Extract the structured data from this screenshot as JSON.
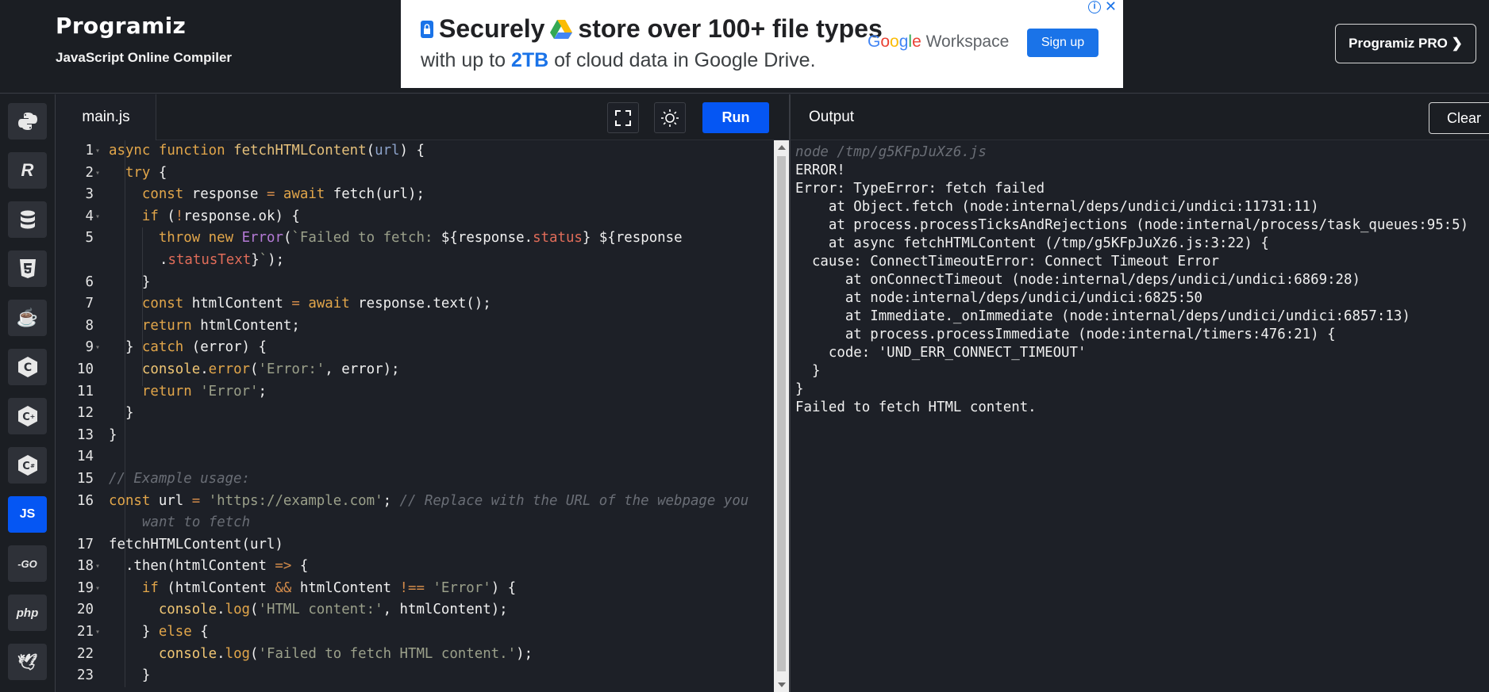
{
  "header": {
    "brand": "Programiz",
    "subtitle": "JavaScript Online Compiler",
    "pro_button": "Programiz PRO ❯"
  },
  "ad": {
    "line1_a": "Securely",
    "line1_b": "store over 100+ file types",
    "line2_a": "with up to",
    "line2_hl": "2TB",
    "line2_b": "of cloud data in Google Drive.",
    "google": [
      "G",
      "o",
      "o",
      "g",
      "l",
      "e"
    ],
    "workspace": " Workspace",
    "signup": "Sign up",
    "info": "i",
    "close": "✕"
  },
  "sidebar": {
    "languages": [
      {
        "name": "python",
        "label": "🐍"
      },
      {
        "name": "r",
        "label": "R"
      },
      {
        "name": "sql",
        "label": "≡"
      },
      {
        "name": "html",
        "label": "5"
      },
      {
        "name": "java",
        "label": "☕"
      },
      {
        "name": "c",
        "label": "C"
      },
      {
        "name": "cpp",
        "label": "C+"
      },
      {
        "name": "csharp",
        "label": "C#"
      },
      {
        "name": "javascript",
        "label": "JS"
      },
      {
        "name": "go",
        "label": "-GO"
      },
      {
        "name": "php",
        "label": "php"
      },
      {
        "name": "swift",
        "label": "🕊"
      }
    ]
  },
  "editor": {
    "file_tab": "main.js",
    "run": "Run",
    "line_numbers": [
      "1",
      "2",
      "3",
      "4",
      "5",
      "6",
      "7",
      "8",
      "9",
      "10",
      "11",
      "12",
      "13",
      "14",
      "15",
      "16",
      "17",
      "18",
      "19",
      "20",
      "21",
      "22",
      "23"
    ]
  },
  "output": {
    "title": "Output",
    "clear": "Clear",
    "lines": [
      "node /tmp/g5KFpJuXz6.js",
      "ERROR!",
      "Error: TypeError: fetch failed",
      "    at Object.fetch (node:internal/deps/undici/undici:11731:11)",
      "    at process.processTicksAndRejections (node:internal/process/task_queues:95:5)",
      "    at async fetchHTMLContent (/tmp/g5KFpJuXz6.js:3:22) {",
      "  cause: ConnectTimeoutError: Connect Timeout Error",
      "      at onConnectTimeout (node:internal/deps/undici/undici:6869:28)",
      "      at node:internal/deps/undici/undici:6825:50",
      "      at Immediate._onImmediate (node:internal/deps/undici/undici:6857:13)",
      "      at process.processImmediate (node:internal/timers:476:21) {",
      "    code: 'UND_ERR_CONNECT_TIMEOUT'",
      "  }",
      "}",
      "Failed to fetch HTML content."
    ]
  },
  "code": {
    "l1": [
      "async",
      "function",
      "fetchHTMLContent",
      "(",
      "url",
      ") {"
    ],
    "l2": [
      "try",
      " {"
    ],
    "l3": [
      "const",
      " response ",
      "=",
      " ",
      "await",
      " fetch(url);"
    ],
    "l4": [
      "if",
      " (",
      "!",
      "response.ok) {"
    ],
    "l5": [
      "throw",
      " ",
      "new",
      " ",
      "Error",
      "(",
      "`Failed to fetch: ",
      "${",
      "response.",
      "status",
      "}",
      " ",
      "${",
      "response"
    ],
    "l5b": [
      ".",
      "statusText",
      "}",
      "`",
      ");"
    ],
    "l6": [
      "}"
    ],
    "l7": [
      "const",
      " htmlContent ",
      "=",
      " ",
      "await",
      " response.text();"
    ],
    "l8": [
      "return",
      " htmlContent;"
    ],
    "l9": [
      "} ",
      "catch",
      " (error) {"
    ],
    "l10": [
      "console",
      ".",
      "error",
      "(",
      "'Error:'",
      ", error);"
    ],
    "l11": [
      "return",
      " ",
      "'Error'",
      ";"
    ],
    "l12": [
      "}"
    ],
    "l13": [
      "}"
    ],
    "l15": [
      "// Example usage:"
    ],
    "l16": [
      "const",
      " url ",
      "=",
      " ",
      "'https://example.com'",
      "; ",
      "// Replace with the URL of the webpage you"
    ],
    "l16b": [
      "want to fetch"
    ],
    "l17": [
      "fetchHTMLContent(url)"
    ],
    "l18": [
      ".then(htmlContent ",
      "=>",
      " {"
    ],
    "l19": [
      "if",
      " (htmlContent ",
      "&&",
      " htmlContent ",
      "!==",
      " ",
      "'Error'",
      ") {"
    ],
    "l20": [
      "console",
      ".",
      "log",
      "(",
      "'HTML content:'",
      ", htmlContent);"
    ],
    "l21": [
      "} ",
      "else",
      " {"
    ],
    "l22": [
      "console",
      ".",
      "log",
      "(",
      "'Failed to fetch HTML content.'",
      ");"
    ],
    "l23": [
      "}"
    ]
  },
  "colors": {
    "run_button": "#0556f3",
    "keyword": "#e2a64a",
    "string": "#9ba08a",
    "comment": "#6a6e76"
  }
}
